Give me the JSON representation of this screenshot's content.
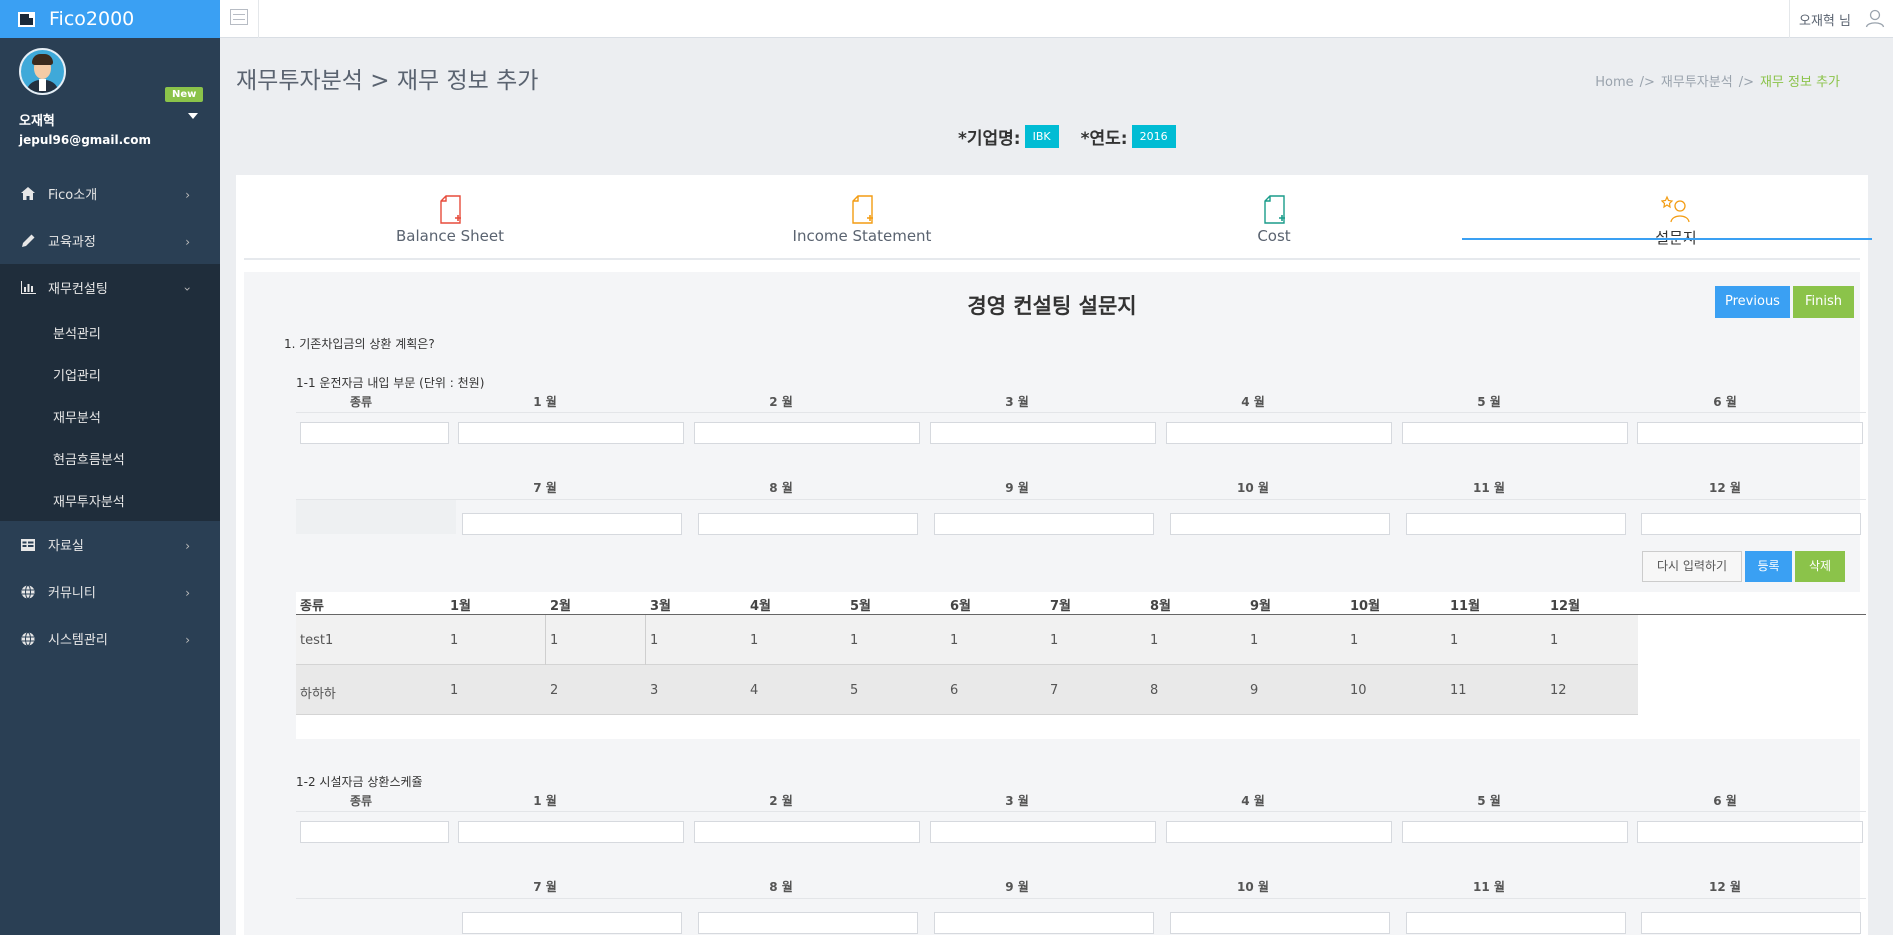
{
  "app": {
    "brand": "Fico2000"
  },
  "sidebar": {
    "new_badge": "New",
    "user_name": "오재혁",
    "user_email": "jepul96@gmail.com",
    "menu": [
      {
        "label": "Fico소개",
        "icon": "home-icon"
      },
      {
        "label": "교육과정",
        "icon": "pencil-icon"
      },
      {
        "label": "재무컨설팅",
        "icon": "bar-chart-icon"
      }
    ],
    "submenu": [
      {
        "label": "분석관리"
      },
      {
        "label": "기업관리"
      },
      {
        "label": "재무분석"
      },
      {
        "label": "현금흐름분석"
      },
      {
        "label": "재무투자분석"
      }
    ],
    "menu2": [
      {
        "label": "자료실",
        "icon": "table-icon"
      },
      {
        "label": "커뮤니티",
        "icon": "globe-icon"
      },
      {
        "label": "시스템관리",
        "icon": "globe-icon"
      }
    ]
  },
  "topbar": {
    "user": "오재혁 님"
  },
  "page": {
    "title": "재무투자분석 > 재무 정보 추가",
    "breadcrumb": {
      "home": "Home",
      "parent": "재무투자분석",
      "current": "재무 정보 추가"
    },
    "company_label": "*기업명:",
    "company": "IBK",
    "year_label": "*연도:",
    "year": "2016"
  },
  "tabs": [
    {
      "label": "Balance Sheet",
      "color": "#e74c3c"
    },
    {
      "label": "Income Statement",
      "color": "#f39c12"
    },
    {
      "label": "Cost",
      "color": "#1a9c8a"
    },
    {
      "label": "설문지",
      "color": "#f39c12"
    }
  ],
  "survey": {
    "title": "경영 컨설팅 설문지",
    "previous": "Previous",
    "finish": "Finish",
    "question1": "1. 기존차입금의 상환 계획은?",
    "section1": "1-1 운전자금 내입 부문 (단위 : 천원)",
    "section2": "1-2 시설자금 상환스케쥴",
    "type_header": "종류",
    "months_row1": [
      "1 월",
      "2 월",
      "3 월",
      "4 월",
      "5 월",
      "6 월"
    ],
    "months_row2": [
      "7 월",
      "8 월",
      "9 월",
      "10 월",
      "11 월",
      "12 월"
    ],
    "btn_reset": "다시 입력하기",
    "btn_register": "등록",
    "btn_delete": "삭제"
  },
  "table": {
    "headers": [
      "종류",
      "1월",
      "2월",
      "3월",
      "4월",
      "5월",
      "6월",
      "7월",
      "8월",
      "9월",
      "10월",
      "11월",
      "12월"
    ],
    "rows": [
      [
        "test1",
        "1",
        "1",
        "1",
        "1",
        "1",
        "1",
        "1",
        "1",
        "1",
        "1",
        "1",
        "1"
      ],
      [
        "하하하",
        "1",
        "2",
        "3",
        "4",
        "5",
        "6",
        "7",
        "8",
        "9",
        "10",
        "11",
        "12"
      ]
    ]
  }
}
